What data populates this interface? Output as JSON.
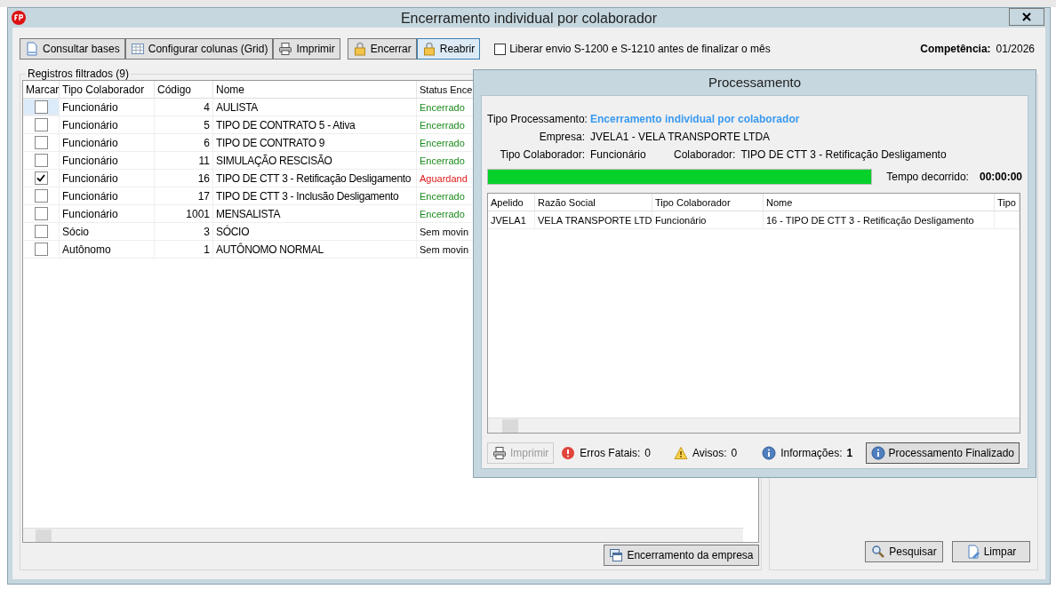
{
  "window": {
    "title": "Encerramento individual por colaborador"
  },
  "toolbar": {
    "buttons": [
      {
        "label": "Consultar bases",
        "selected": false
      },
      {
        "label": "Configurar colunas (Grid)",
        "selected": false
      },
      {
        "label": "Imprimir",
        "selected": false
      },
      {
        "label": "Encerrar",
        "selected": false
      },
      {
        "label": "Reabrir",
        "selected": true
      }
    ],
    "option": {
      "label": "Liberar envio S-1200 e S-1210 antes de finalizar o mês",
      "checked": false
    },
    "competencia": {
      "label": "Competência:",
      "value": "01/2026"
    }
  },
  "records": {
    "title": "Registros filtrados (9)",
    "columns": [
      "Marcar",
      "Tipo Colaborador",
      "Código",
      "Nome",
      "Status Ence"
    ],
    "rows": [
      {
        "checked": false,
        "focused": true,
        "tipo": "Funcionário",
        "codigo": "4",
        "nome": "AULISTA",
        "status": "Encerrado",
        "color": "#1a8a1a"
      },
      {
        "checked": false,
        "focused": false,
        "tipo": "Funcionário",
        "codigo": "5",
        "nome": "TIPO DE CONTRATO 5 - Ativa",
        "status": "Encerrado",
        "color": "#1a8a1a"
      },
      {
        "checked": false,
        "focused": false,
        "tipo": "Funcionário",
        "codigo": "6",
        "nome": "TIPO DE CONTRATO 9",
        "status": "Encerrado",
        "color": "#1a8a1a"
      },
      {
        "checked": false,
        "focused": false,
        "tipo": "Funcionário",
        "codigo": "11",
        "nome": "SIMULAÇÃO RESCISÃO",
        "status": "Encerrado",
        "color": "#1a8a1a"
      },
      {
        "checked": true,
        "focused": false,
        "tipo": "Funcionário",
        "codigo": "16",
        "nome": "TIPO DE CTT 3 - Retificação Desligamento",
        "status": "Aguardand",
        "color": "#e01818"
      },
      {
        "checked": false,
        "focused": false,
        "tipo": "Funcionário",
        "codigo": "17",
        "nome": "TIPO DE CTT 3 - Inclusão Desligamento",
        "status": "Encerrado",
        "color": "#1a8a1a"
      },
      {
        "checked": false,
        "focused": false,
        "tipo": "Funcionário",
        "codigo": "1001",
        "nome": "MENSALISTA",
        "status": "Encerrado",
        "color": "#1a8a1a"
      },
      {
        "checked": false,
        "focused": false,
        "tipo": "Sócio",
        "codigo": "3",
        "nome": "SÓCIO",
        "status": "Sem movin"
      },
      {
        "checked": false,
        "focused": false,
        "tipo": "Autônomo",
        "codigo": "1",
        "nome": "AUTÔNOMO NORMAL",
        "status": "Sem movin"
      }
    ],
    "button": {
      "label": "Encerramento da empresa"
    }
  },
  "side_buttons": [
    {
      "label": "Pesquisar"
    },
    {
      "label": "Limpar"
    }
  ],
  "dialog": {
    "title": "Processamento",
    "fields": [
      {
        "label": "Tipo Processamento:",
        "value": "Encerramento individual por colaborador",
        "highlight": true
      },
      {
        "label": "Empresa:",
        "value": "JVELA1 - VELA TRANSPORTE LTDA",
        "highlight": false
      }
    ],
    "tipo_colaborador": {
      "label": "Tipo Colaborador:",
      "value": "Funcionário"
    },
    "colaborador": {
      "label": "Colaborador:",
      "value": "TIPO DE CTT 3 - Retificação Desligamento"
    },
    "progress": {
      "level": 1
    },
    "elapsed": {
      "label": "Tempo decorrido:",
      "value": "00:00:00"
    },
    "columns": [
      "Apelido",
      "Razão Social",
      "Tipo Colaborador",
      "Nome",
      "Tipo"
    ],
    "rows": [
      [
        "JVELA1",
        "VELA TRANSPORTE LTD",
        "Funcionário",
        "16 - TIPO DE CTT 3 - Retificação Desligamento"
      ]
    ],
    "print_button": {
      "label": "Imprimir",
      "disabled": true
    },
    "counters": [
      {
        "kind": "error",
        "label": "Erros Fatais:",
        "value": "0"
      },
      {
        "kind": "warning",
        "label": "Avisos:",
        "value": "0"
      },
      {
        "kind": "info",
        "label": "Informações:",
        "value": "1"
      }
    ],
    "finish_button": {
      "label": "Processamento Finalizado"
    }
  }
}
